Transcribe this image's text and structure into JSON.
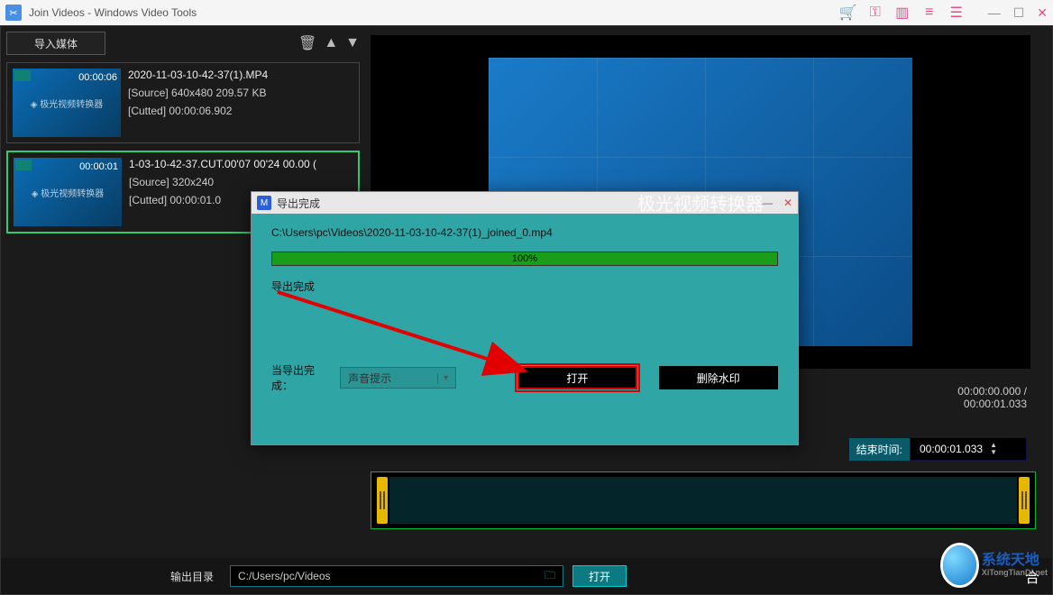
{
  "titlebar": {
    "title": "Join Videos - Windows Video Tools"
  },
  "left": {
    "import_label": "导入媒体",
    "items": [
      {
        "duration": "00:00:06",
        "filename": "2020-11-03-10-42-37(1).MP4",
        "source": "[Source] 640x480 209.57 KB",
        "cutted": "[Cutted] 00:00:06.902"
      },
      {
        "duration": "00:00:01",
        "filename": "1-03-10-42-37.CUT.00'07  00'24  00.00 (",
        "source": "[Source] 320x240 ",
        "cutted": "[Cutted] 00:00:01.0"
      }
    ]
  },
  "preview": {
    "center_text": "极光视频转换器"
  },
  "time": {
    "current": "00:00:00.000 /",
    "total": "00:00:01.033",
    "end_label": "结束时间:",
    "end_value": "00:00:01.033"
  },
  "bottom": {
    "label": "输出目录",
    "path": "C:/Users/pc/Videos",
    "open": "打开",
    "merge": "合"
  },
  "dialog": {
    "title": "导出完成",
    "path": "C:\\Users\\pc\\Videos\\2020-11-03-10-42-37(1)_joined_0.mp4",
    "percent": "100%",
    "status": "导出完成",
    "on_complete_label": "当导出完成：",
    "select_value": "声音提示",
    "open_btn": "打开",
    "remove_wm_btn": "删除水印"
  },
  "watermark": {
    "name": "系统天地",
    "url": "XiTongTianDi.net"
  }
}
